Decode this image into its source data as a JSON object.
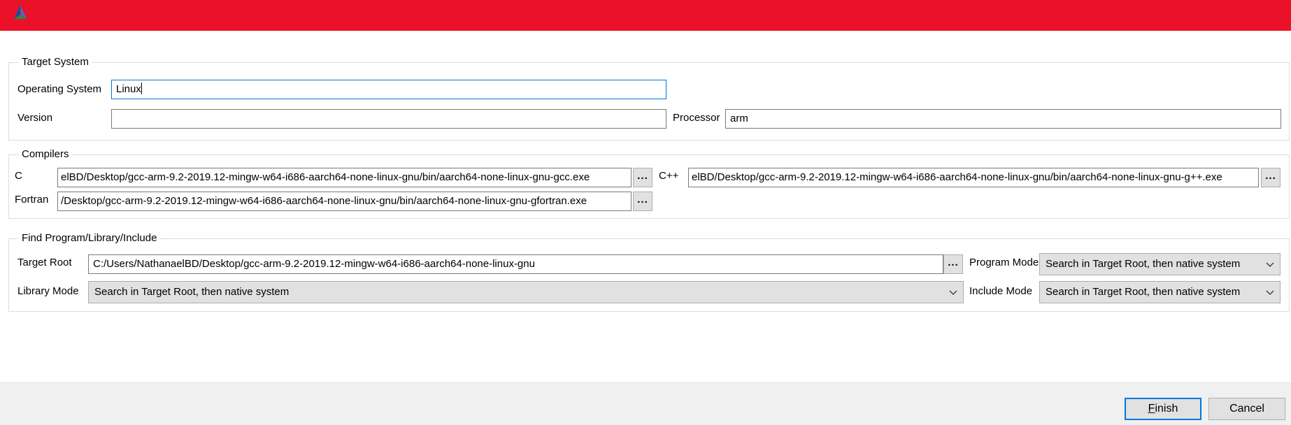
{
  "window": {
    "titlebar_color": "#eb1128",
    "icon": "cmake-triangle-icon"
  },
  "target_system": {
    "title": "Target System",
    "os_label": "Operating System",
    "os_value": "Linux",
    "version_label": "Version",
    "version_value": "",
    "processor_label": "Processor",
    "processor_value": "arm"
  },
  "compilers": {
    "title": "Compilers",
    "c_label": "C",
    "c_value": "elBD/Desktop/gcc-arm-9.2-2019.12-mingw-w64-i686-aarch64-none-linux-gnu/bin/aarch64-none-linux-gnu-gcc.exe",
    "cxx_label": "C++",
    "cxx_value": "elBD/Desktop/gcc-arm-9.2-2019.12-mingw-w64-i686-aarch64-none-linux-gnu/bin/aarch64-none-linux-gnu-g++.exe",
    "fortran_label": "Fortran",
    "fortran_value": "/Desktop/gcc-arm-9.2-2019.12-mingw-w64-i686-aarch64-none-linux-gnu/bin/aarch64-none-linux-gnu-gfortran.exe",
    "browse_label": "..."
  },
  "find": {
    "title": "Find Program/Library/Include",
    "target_root_label": "Target Root",
    "target_root_value": "C:/Users/NathanaelBD/Desktop/gcc-arm-9.2-2019.12-mingw-w64-i686-aarch64-none-linux-gnu",
    "browse_label": "...",
    "program_mode_label": "Program Mode",
    "program_mode_value": "Search in Target Root, then native system",
    "library_mode_label": "Library Mode",
    "library_mode_value": "Search in Target Root, then native system",
    "include_mode_label": "Include Mode",
    "include_mode_value": "Search in Target Root, then native system"
  },
  "footer": {
    "finish_mnemonic": "F",
    "finish_rest": "inish",
    "cancel_label": "Cancel"
  }
}
